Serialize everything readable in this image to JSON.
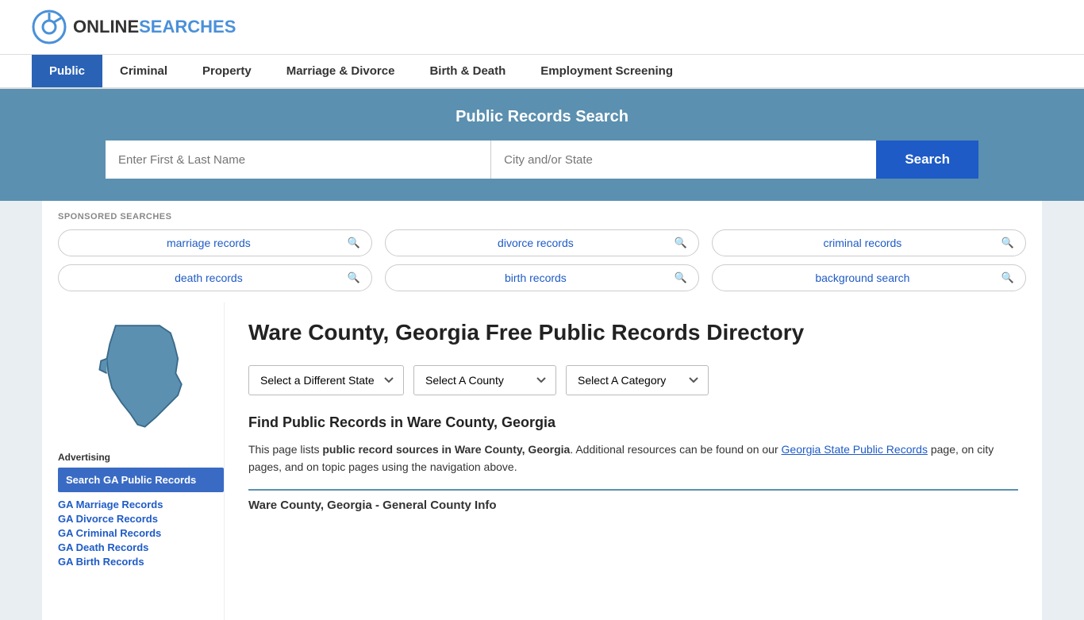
{
  "header": {
    "logo_text_online": "ONLINE",
    "logo_text_searches": "SEARCHES"
  },
  "nav": {
    "items": [
      {
        "label": "Public",
        "active": true
      },
      {
        "label": "Criminal",
        "active": false
      },
      {
        "label": "Property",
        "active": false
      },
      {
        "label": "Marriage & Divorce",
        "active": false
      },
      {
        "label": "Birth & Death",
        "active": false
      },
      {
        "label": "Employment Screening",
        "active": false
      }
    ]
  },
  "search_banner": {
    "title": "Public Records Search",
    "name_placeholder": "Enter First & Last Name",
    "location_placeholder": "City and/or State",
    "button_label": "Search"
  },
  "sponsored": {
    "label": "SPONSORED SEARCHES",
    "pills": [
      {
        "text": "marriage records"
      },
      {
        "text": "divorce records"
      },
      {
        "text": "criminal records"
      },
      {
        "text": "death records"
      },
      {
        "text": "birth records"
      },
      {
        "text": "background search"
      }
    ]
  },
  "sidebar": {
    "ad_label": "Advertising",
    "ad_active_label": "Search GA Public Records",
    "links": [
      {
        "label": "GA Marriage Records"
      },
      {
        "label": "GA Divorce Records"
      },
      {
        "label": "GA Criminal Records"
      },
      {
        "label": "GA Death Records"
      },
      {
        "label": "GA Birth Records"
      }
    ]
  },
  "main": {
    "page_title": "Ware County, Georgia Free Public Records Directory",
    "dropdowns": {
      "state_label": "Select a Different State",
      "county_label": "Select A County",
      "category_label": "Select A Category"
    },
    "find_records_title": "Find Public Records in Ware County, Georgia",
    "find_records_text_before": "This page lists ",
    "find_records_bold": "public record sources in Ware County, Georgia",
    "find_records_text_middle": ". Additional resources can be found on our ",
    "find_records_link": "Georgia State Public Records",
    "find_records_text_after": " page, on city pages, and on topic pages using the navigation above.",
    "county_info_bar_title": "Ware County, Georgia - General County Info"
  }
}
